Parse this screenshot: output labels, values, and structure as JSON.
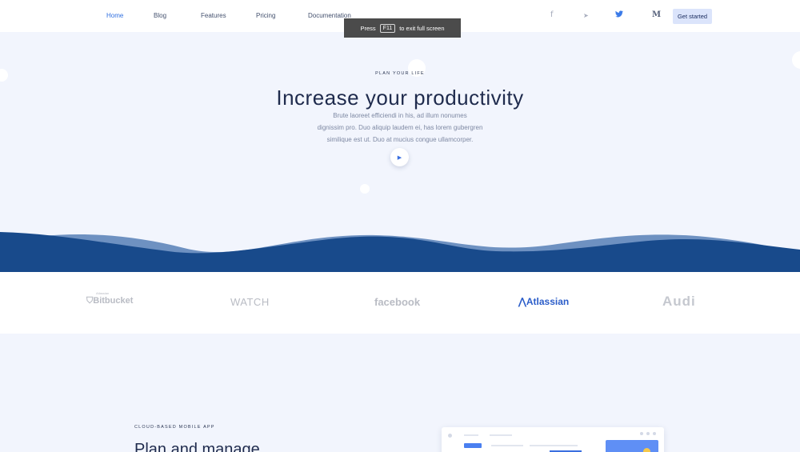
{
  "nav": {
    "links": [
      "Home",
      "Blog",
      "Features",
      "Pricing",
      "Documentation"
    ],
    "social": [
      {
        "icon": "facebook-icon",
        "glyph": "f"
      },
      {
        "icon": "telegram-icon",
        "glyph": "➤"
      },
      {
        "icon": "twitter-icon",
        "glyph": "🐦"
      },
      {
        "icon": "medium-icon",
        "glyph": "M"
      }
    ],
    "cta_label": "Get started"
  },
  "toast": {
    "press": "Press",
    "key": "F11",
    "rest": "to exit full screen"
  },
  "hero": {
    "eyebrow": "PLAN YOUR LIFE",
    "headline": "Increase your productivity",
    "sub_lines": [
      "Brute laoreet efficiendi in his, ad illum nonumes",
      "dignissim pro. Duo aliquip laudem ei, has lorem gubergren",
      "similique est ut. Duo at mucius congue ullamcorper."
    ]
  },
  "logos": {
    "bitbucket_small": "Atlassian",
    "bitbucket": "Bitbucket",
    "watch": "WATCH",
    "facebook": "facebook",
    "atlassian": "Atlassian",
    "audi": "Audi"
  },
  "lower": {
    "eyebrow": "CLOUD-BASED MOBILE APP",
    "heading": "Plan and manage"
  },
  "colors": {
    "accent": "#2f6fe0",
    "wave_dark": "#184a8b",
    "wave_light": "#6e91c1",
    "hero_bg": "#f2f5fd"
  }
}
